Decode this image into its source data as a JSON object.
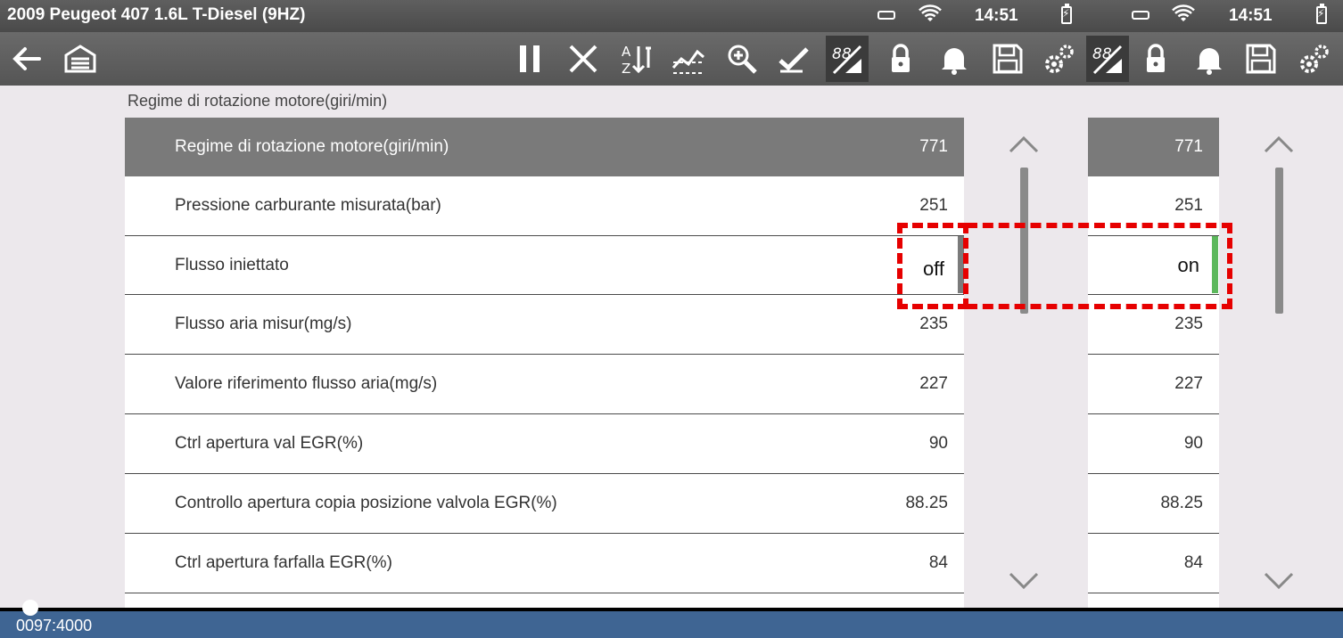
{
  "status_bar": {
    "title": "2009 Peugeot 407 1.6L T-Diesel (9HZ)",
    "time_left": "14:51",
    "time_right": "14:51"
  },
  "toolbar": {
    "icons": [
      "back-arrow-icon",
      "garage-icon",
      "pause-icon",
      "close-icon",
      "sort-az-icon",
      "graph-icon",
      "zoom-icon",
      "check-icon",
      "digits-icon",
      "lock-icon",
      "bell-icon",
      "save-icon",
      "settings-icon",
      "digits-icon",
      "lock-icon",
      "bell-icon",
      "save-icon",
      "settings-icon"
    ]
  },
  "section_title": "Regime di rotazione motore(giri/min)",
  "rows": [
    {
      "name": "Regime di rotazione motore(giri/min)",
      "value": "771",
      "value2": "771"
    },
    {
      "name": "Pressione carburante misurata(bar)",
      "value": "251",
      "value2": "251"
    },
    {
      "name": "Flusso iniettato",
      "value": "off",
      "value2": "on"
    },
    {
      "name": "Flusso aria misur(mg/s)",
      "value": "235",
      "value2": "235"
    },
    {
      "name": "Valore riferimento flusso aria(mg/s)",
      "value": "227",
      "value2": "227"
    },
    {
      "name": "Ctrl apertura val EGR(%)",
      "value": "90",
      "value2": "90"
    },
    {
      "name": "Controllo apertura copia posizione valvola EGR(%)",
      "value": "88.25",
      "value2": "88.25"
    },
    {
      "name": "Ctrl apertura farfalla EGR(%)",
      "value": "84",
      "value2": "84"
    }
  ],
  "playback": {
    "position": "0097:4000"
  },
  "colors": {
    "header_row": "#7a7a7a",
    "highlight": "#e60000",
    "on_indicator": "#5cb85c",
    "off_indicator": "#7a7a7a",
    "bottom_bar": "#3f6593"
  }
}
